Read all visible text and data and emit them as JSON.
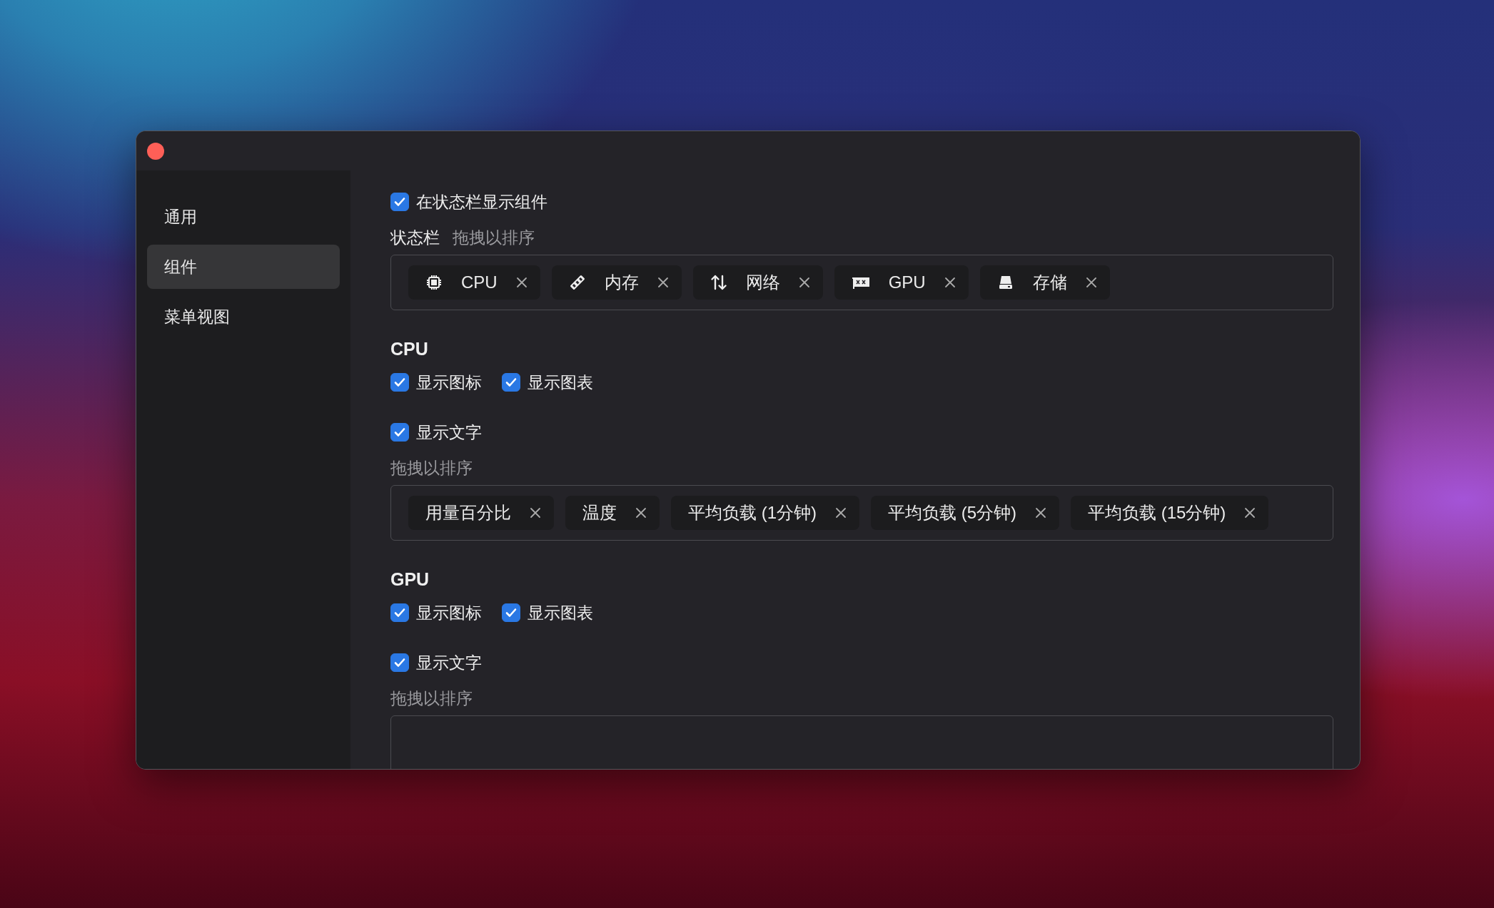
{
  "sidebar": {
    "items": [
      {
        "label": "通用",
        "selected": false
      },
      {
        "label": "组件",
        "selected": true
      },
      {
        "label": "菜单视图",
        "selected": false
      }
    ]
  },
  "status_bar_toggle": {
    "label": "在状态栏显示组件",
    "checked": true
  },
  "status_bar_order": {
    "title": "状态栏",
    "hint": "拖拽以排序",
    "items": [
      {
        "kind": "cpu",
        "label": "CPU"
      },
      {
        "kind": "memory",
        "label": "内存"
      },
      {
        "kind": "network",
        "label": "网络"
      },
      {
        "kind": "gpu",
        "label": "GPU"
      },
      {
        "kind": "storage",
        "label": "存储"
      }
    ]
  },
  "sections": [
    {
      "title": "CPU",
      "option_rows": [
        [
          {
            "label": "显示图标",
            "checked": true
          },
          {
            "label": "显示图表",
            "checked": true
          }
        ],
        [
          {
            "label": "显示文字",
            "checked": true
          }
        ]
      ],
      "hint": "拖拽以排序",
      "items": [
        {
          "label": "用量百分比"
        },
        {
          "label": "温度"
        },
        {
          "label": "平均负载 (1分钟)"
        },
        {
          "label": "平均负载 (5分钟)"
        },
        {
          "label": "平均负载 (15分钟)"
        }
      ]
    },
    {
      "title": "GPU",
      "option_rows": [
        [
          {
            "label": "显示图标",
            "checked": true
          },
          {
            "label": "显示图表",
            "checked": true
          }
        ],
        [
          {
            "label": "显示文字",
            "checked": true
          }
        ]
      ],
      "hint": "拖拽以排序"
    }
  ]
}
